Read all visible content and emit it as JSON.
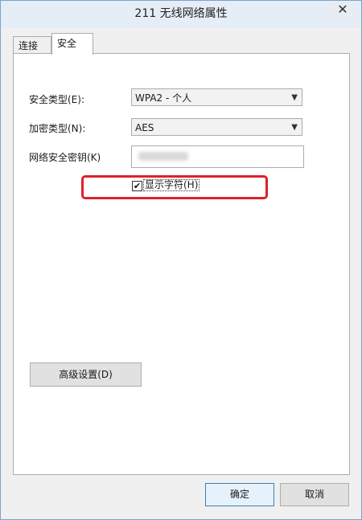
{
  "window": {
    "title": "211 无线网络属性",
    "close_glyph": "✕"
  },
  "tabs": [
    {
      "label": "连接"
    },
    {
      "label": "安全"
    }
  ],
  "security": {
    "security_type_label": "安全类型(E):",
    "security_type_value": "WPA2 - 个人",
    "encryption_type_label": "加密类型(N):",
    "encryption_type_value": "AES",
    "key_label": "网络安全密钥(K)",
    "show_chars_label": "显示字符(H)",
    "show_chars_checked": true,
    "check_glyph": "✔",
    "advanced_button": "高级设置(D)"
  },
  "footer": {
    "ok_button": "确定",
    "cancel_button": "取消"
  },
  "colors": {
    "highlight": "#e0202a",
    "accent": "#3c7fb1"
  }
}
